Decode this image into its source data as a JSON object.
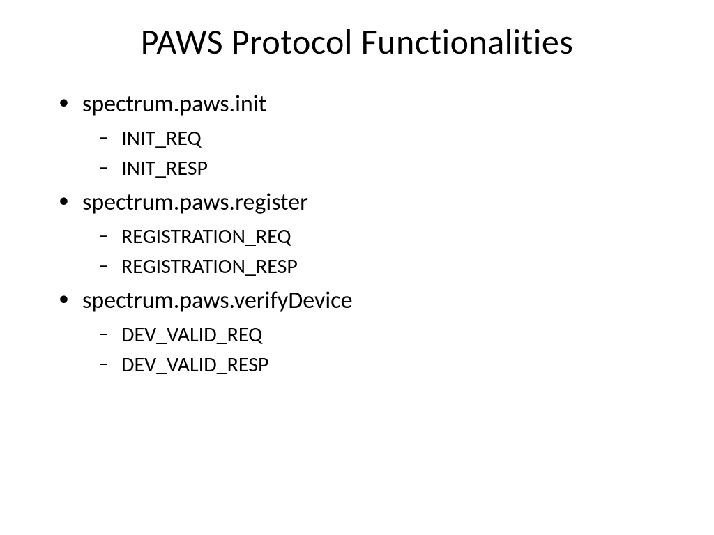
{
  "title": "PAWS Protocol Functionalities",
  "sections": [
    {
      "heading": "spectrum.paws.init",
      "items": [
        "INIT_REQ",
        "INIT_RESP"
      ]
    },
    {
      "heading": "spectrum.paws.register",
      "items": [
        "REGISTRATION_REQ",
        "REGISTRATION_RESP"
      ]
    },
    {
      "heading": "spectrum.paws.verifyDevice",
      "items": [
        "DEV_VALID_REQ",
        "DEV_VALID_RESP"
      ]
    }
  ]
}
